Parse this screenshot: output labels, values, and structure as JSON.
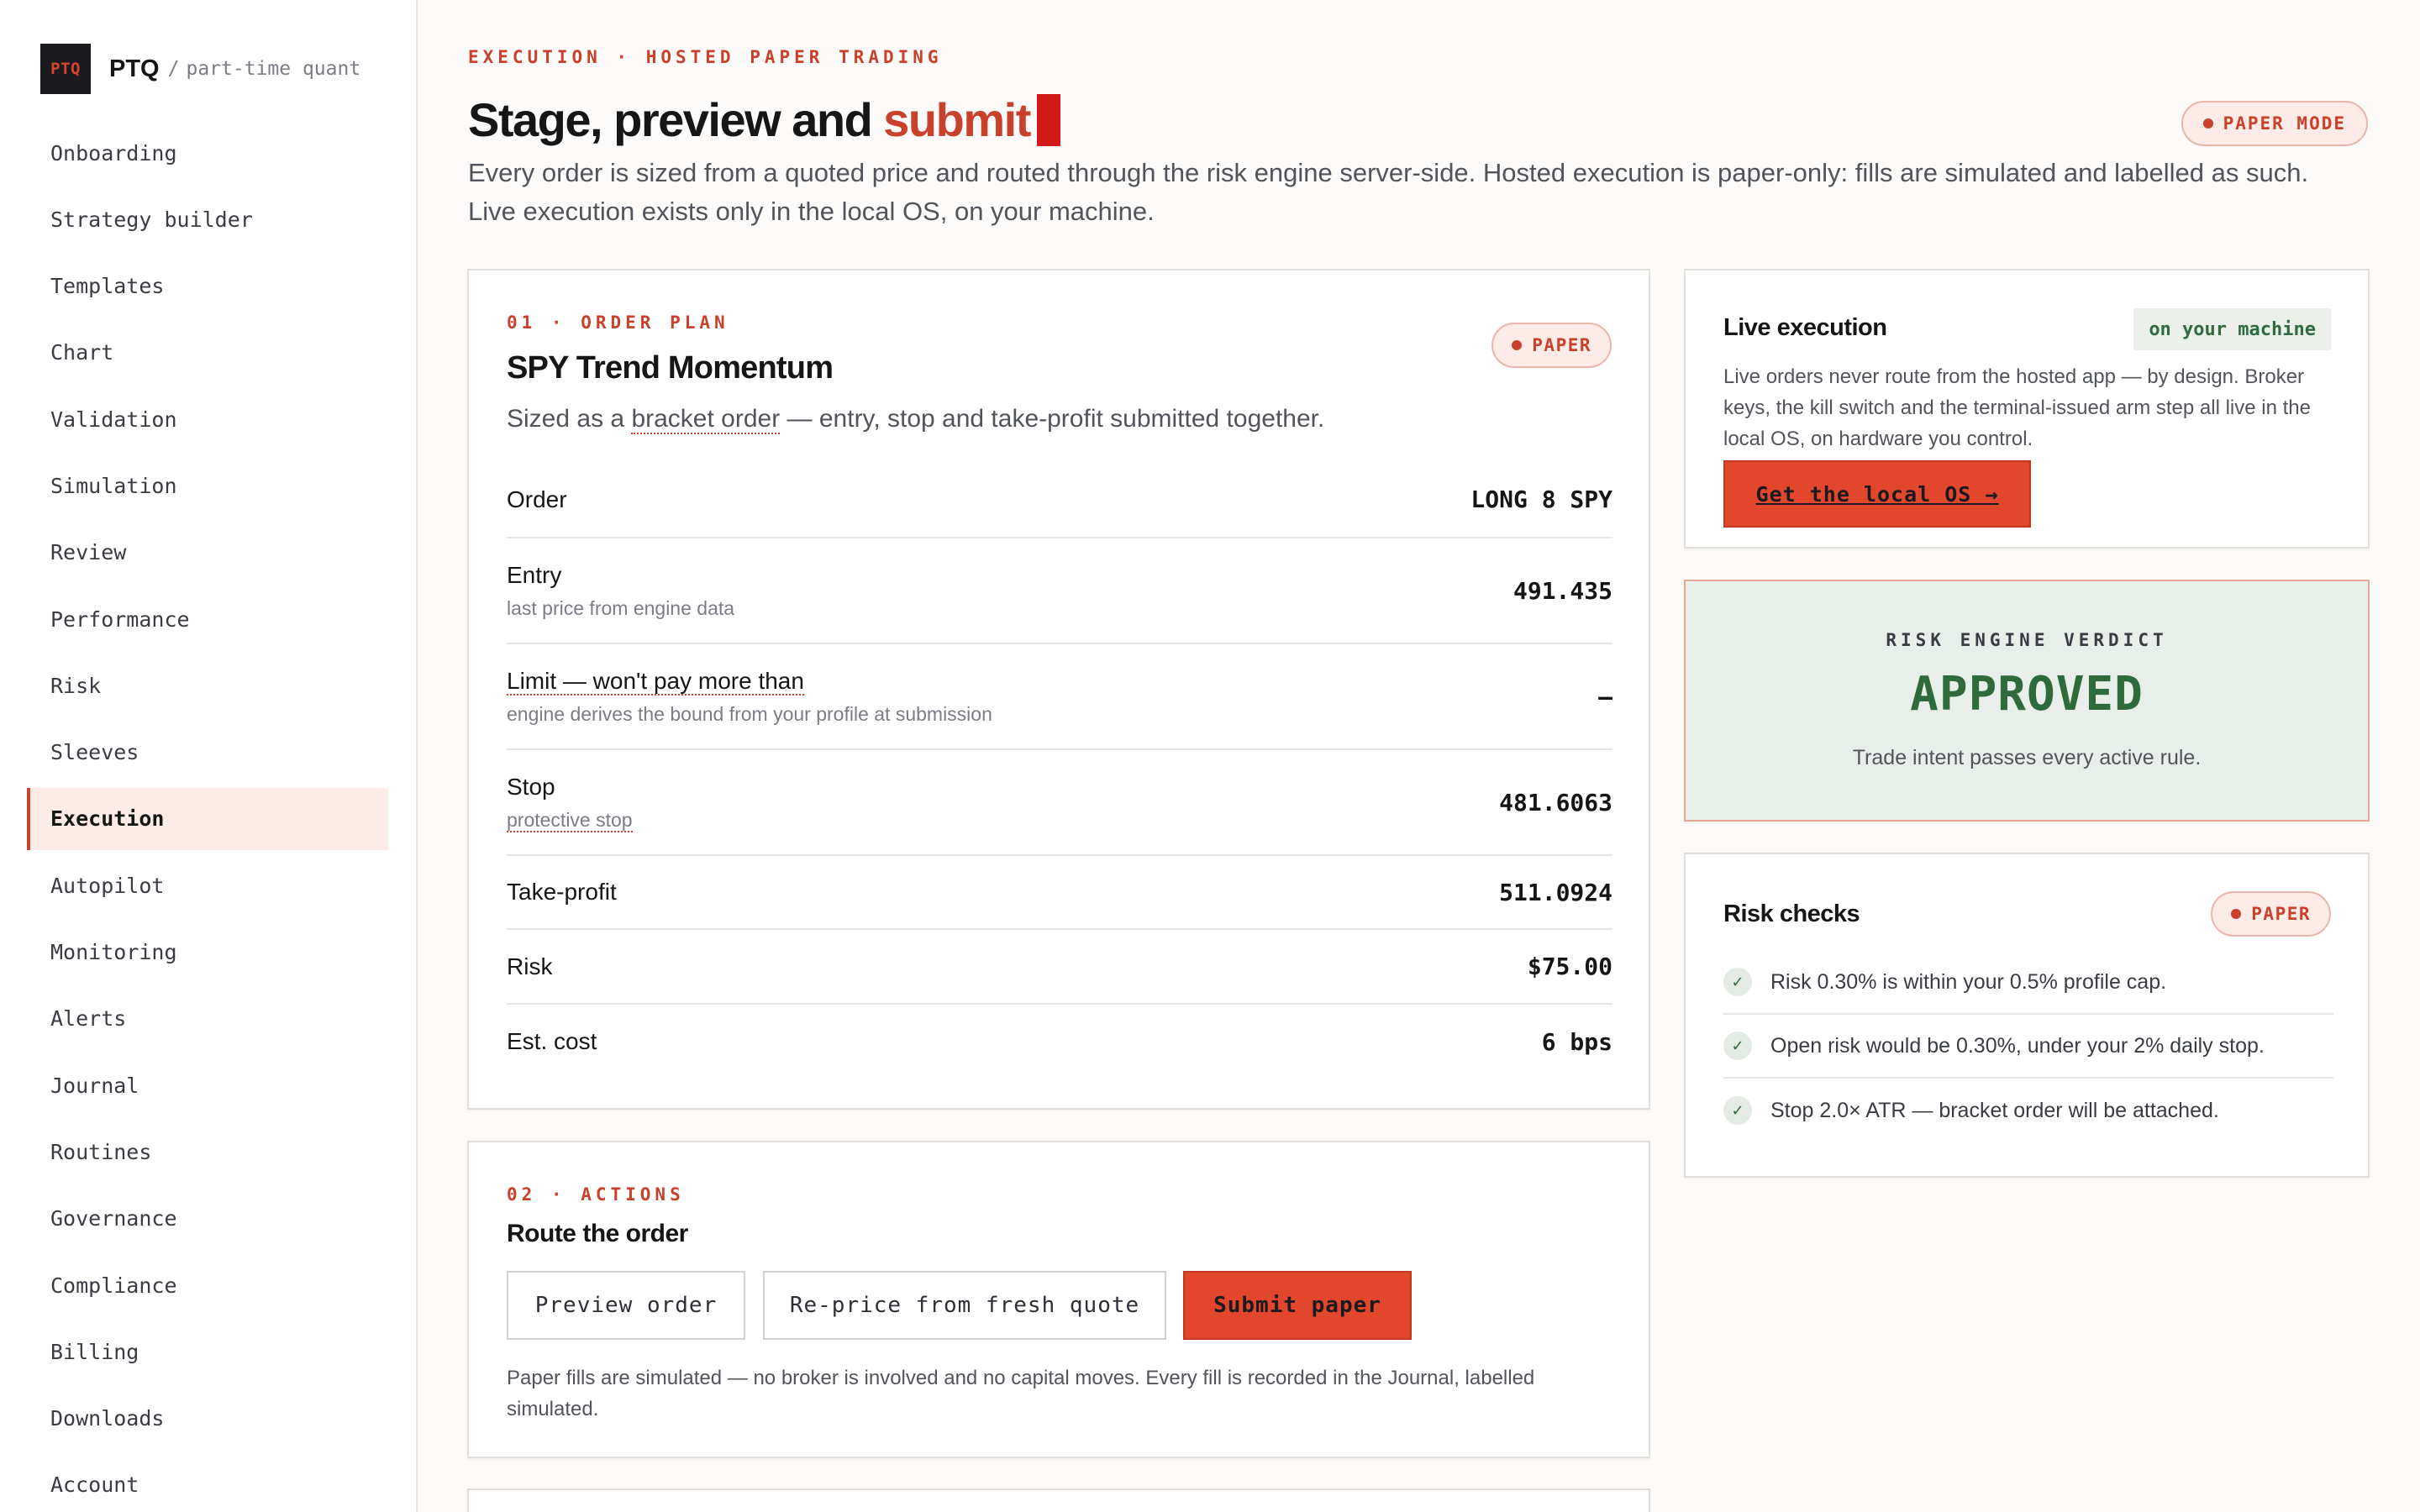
{
  "brand": {
    "logo": "PTQ",
    "name": "PTQ",
    "separator": "/",
    "subtitle": "part-time quant"
  },
  "nav": {
    "items": [
      "Onboarding",
      "Strategy builder",
      "Templates",
      "Chart",
      "Validation",
      "Simulation",
      "Review",
      "Performance",
      "Risk",
      "Sleeves",
      "Execution",
      "Autopilot",
      "Monitoring",
      "Alerts",
      "Journal",
      "Routines",
      "Governance",
      "Compliance",
      "Billing",
      "Downloads",
      "Account"
    ],
    "active": "Execution"
  },
  "header": {
    "eyebrow": "EXECUTION · HOSTED PAPER TRADING",
    "title_main": "Stage, preview and",
    "title_accent": "submit",
    "mode_badge": "PAPER MODE",
    "description": "Every order is sized from a quoted price and routed through the risk engine server-side. Hosted execution is paper-only: fills are simulated and labelled as such. Live execution exists only in the local OS, on your machine."
  },
  "order_plan": {
    "eyebrow": "01 · ORDER PLAN",
    "title": "SPY Trend Momentum",
    "badge": "PAPER",
    "sub_prefix": "Sized as a",
    "sub_link": "bracket order",
    "sub_suffix": "— entry, stop and take-profit submitted together.",
    "rows": [
      {
        "label": "Order",
        "hint": "",
        "value": "LONG 8 SPY"
      },
      {
        "label": "Entry",
        "hint": "last price from engine data",
        "value": "491.435"
      },
      {
        "label": "Limit — won't pay more than",
        "hint": "engine derives the bound from your profile at submission",
        "value": "—"
      },
      {
        "label": "Stop",
        "hint": "protective stop",
        "value": "481.6063"
      },
      {
        "label": "Take-profit",
        "hint": "",
        "value": "511.0924"
      },
      {
        "label": "Risk",
        "hint": "",
        "value": "$75.00"
      },
      {
        "label": "Est. cost",
        "hint": "",
        "value": "6 bps"
      }
    ]
  },
  "actions": {
    "eyebrow": "02 · ACTIONS",
    "title": "Route the order",
    "preview_label": "Preview order",
    "reprice_label": "Re-price from fresh quote",
    "submit_label": "Submit paper",
    "note": "Paper fills are simulated — no broker is involved and no capital moves. Every fill is recorded in the Journal, labelled simulated."
  },
  "live": {
    "title": "Live execution",
    "tag": "on your machine",
    "description": "Live orders never route from the hosted app — by design. Broker keys, the kill switch and the terminal-issued arm step all live in the local OS, on hardware you control.",
    "button": "Get the local OS →"
  },
  "verdict": {
    "eyebrow": "RISK ENGINE VERDICT",
    "status": "APPROVED",
    "sub": "Trade intent passes every active rule."
  },
  "checks": {
    "title": "Risk checks",
    "badge": "PAPER",
    "items": [
      "Risk 0.30% is within your 0.5% profile cap.",
      "Open risk would be 0.30%, under your 2% daily stop.",
      "Stop 2.0× ATR — bracket order will be attached."
    ]
  },
  "colors": {
    "accent": "#c9412b",
    "primary_button": "#e2462c",
    "approved": "#2e6a3c"
  }
}
